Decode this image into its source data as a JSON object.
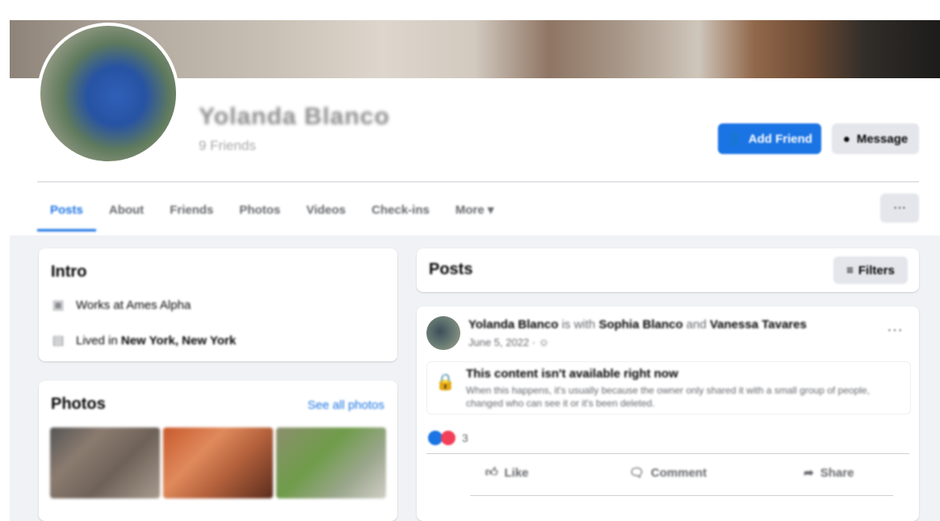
{
  "profile": {
    "name": "Yolanda Blanco",
    "subtitle": "9 Friends",
    "add_friend_label": "Add Friend",
    "message_label": "Message"
  },
  "tabs": [
    {
      "label": "Posts",
      "active": true
    },
    {
      "label": "About"
    },
    {
      "label": "Friends"
    },
    {
      "label": "Photos"
    },
    {
      "label": "Videos"
    },
    {
      "label": "Check-ins"
    },
    {
      "label": "More ▾"
    }
  ],
  "tab_more_label": "···",
  "intro": {
    "title": "Intro",
    "works": "Works at Ames Alpha",
    "lives_prefix": "Lived in ",
    "lives_place": "New York, New York"
  },
  "photos": {
    "title": "Photos",
    "see_all": "See all photos"
  },
  "posts": {
    "title": "Posts",
    "filters_label": "Filters"
  },
  "post": {
    "author": "Yolanda Blanco",
    "with_text": " is with ",
    "tag1": "Sophia Blanco",
    "and_text": " and ",
    "tag2": "Vanessa Tavares",
    "date": "June 5, 2022 · ",
    "menu": "···",
    "locked_title": "This content isn't available right now",
    "locked_body": "When this happens, it's usually because the owner only shared it with a small group of people, changed who can see it or it's been deleted.",
    "reaction_count": "3",
    "like_label": "Like",
    "comment_label": "Comment",
    "share_label": "Share"
  },
  "colors": {
    "accent": "#1b74e4",
    "background": "#f0f2f5"
  }
}
